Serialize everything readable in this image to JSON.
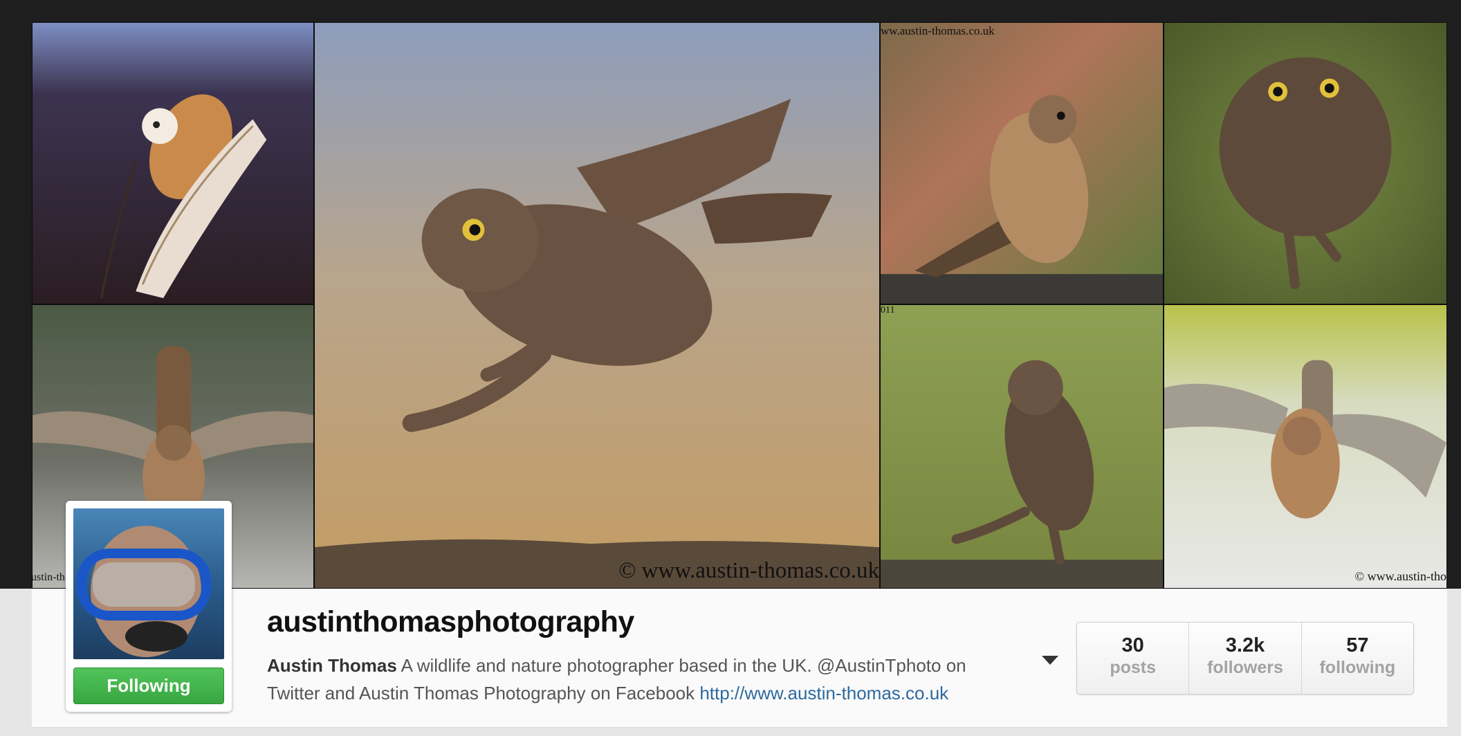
{
  "profile": {
    "username": "austinthomasphotography",
    "full_name": "Austin Thomas",
    "bio_text": " A wildlife and nature photographer based in the UK. @AustinTphoto on Twitter and Austin Thomas Photography on Facebook ",
    "website": "http://www.austin-thomas.co.uk",
    "follow_button_label": "Following"
  },
  "stats": [
    {
      "value": "30",
      "label": "posts"
    },
    {
      "value": "3.2k",
      "label": "followers"
    },
    {
      "value": "57",
      "label": "following"
    }
  ],
  "header_photos": {
    "watermarks": {
      "top_right_tile": "ww.austin-thomas.co.uk",
      "bottom_left_tile": "ustin-th",
      "large_tile": "© www.austin-thomas.co.uk",
      "bottom_right_tile": "© www.austin-tho",
      "small_fragment": "011"
    }
  },
  "icons": {
    "more_options": "caret-down-icon"
  },
  "colors": {
    "follow_button": "#3aa843",
    "link": "#2d6aa0"
  }
}
